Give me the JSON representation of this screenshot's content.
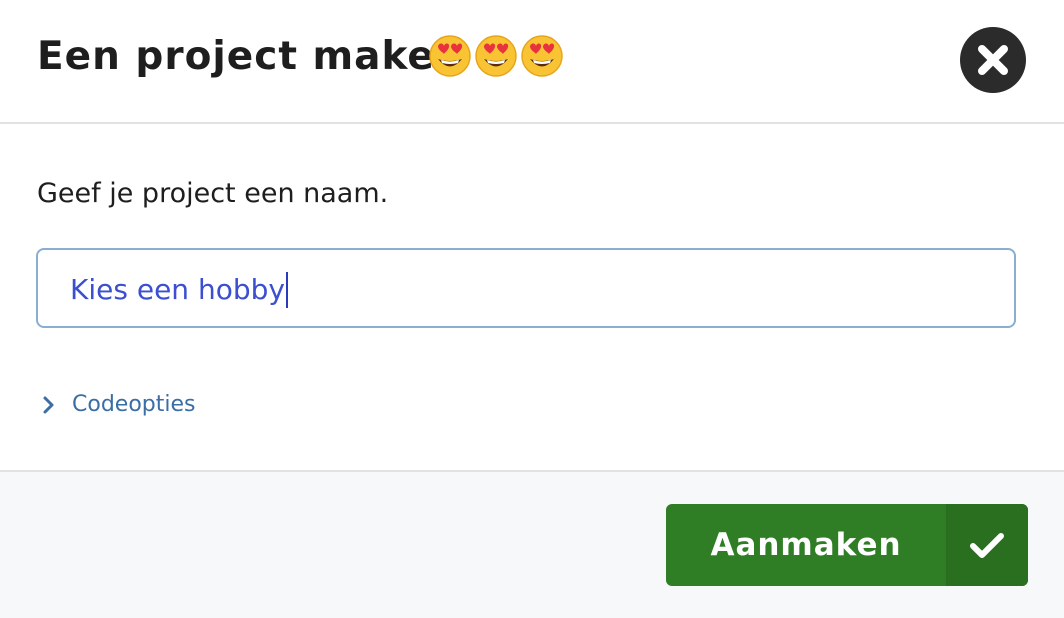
{
  "dialog": {
    "title": "Een project maken",
    "title_emojis": [
      "smiling-face-with-heart-eyes",
      "smiling-face-with-heart-eyes",
      "smiling-face-with-heart-eyes"
    ],
    "close_icon": "close-icon"
  },
  "form": {
    "prompt": "Geef je project een naam.",
    "name_value": "Kies een hobby",
    "code_options_label": "Codeopties",
    "code_options_icon": "chevron-right-icon"
  },
  "footer": {
    "create_label": "Aanmaken",
    "create_icon": "checkmark-icon"
  },
  "colors": {
    "primary_green": "#2f7d24",
    "link_blue": "#3a6ea5",
    "input_text": "#3b4fd0",
    "input_border": "#8aaed2",
    "close_bg": "#2b2b2b"
  }
}
